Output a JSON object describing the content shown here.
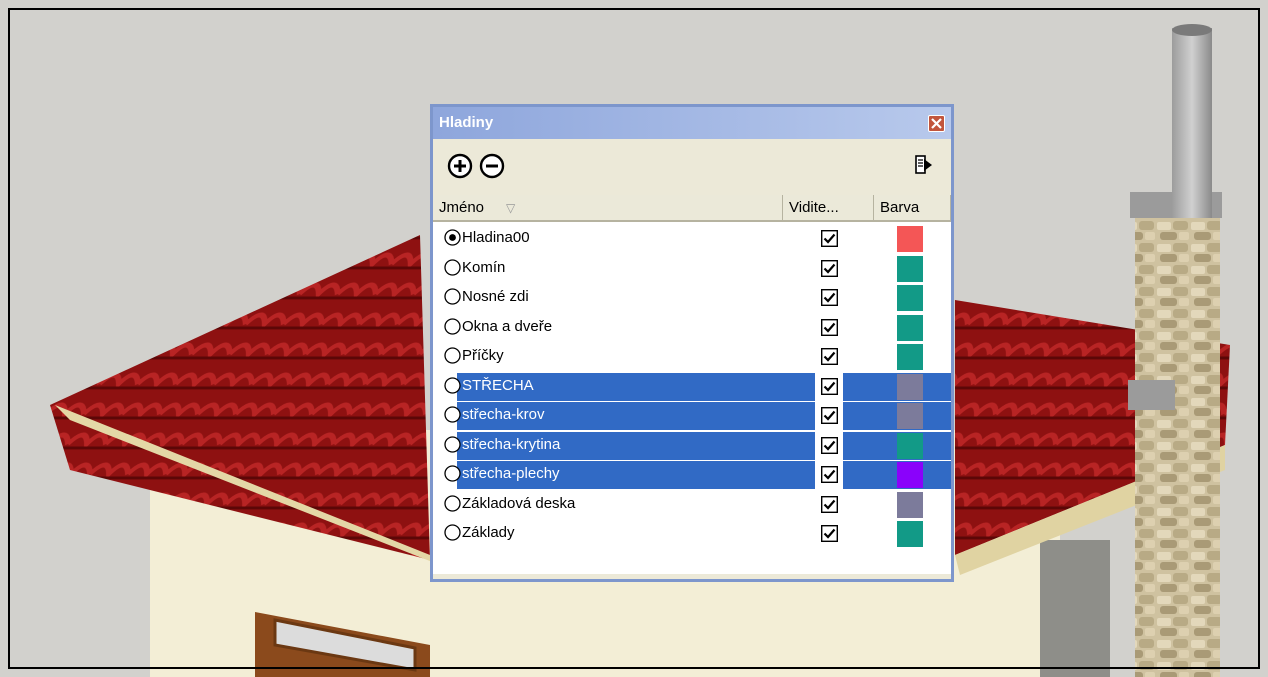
{
  "dialog": {
    "title": "Hladiny",
    "toolbar": {
      "add_icon": "plus-circle-icon",
      "remove_icon": "minus-circle-icon",
      "details_icon": "details-arrow-icon"
    },
    "columns": {
      "name": "Jméno",
      "visible": "Vidite...",
      "color": "Barva"
    },
    "layers": [
      {
        "name": "Hladina00",
        "active": true,
        "visible": true,
        "selected": false,
        "color": "#f45656"
      },
      {
        "name": "Komín",
        "active": false,
        "visible": true,
        "selected": false,
        "color": "#129a87"
      },
      {
        "name": "Nosné zdi",
        "active": false,
        "visible": true,
        "selected": false,
        "color": "#129a87"
      },
      {
        "name": "Okna a dveře",
        "active": false,
        "visible": true,
        "selected": false,
        "color": "#129a87"
      },
      {
        "name": "Příčky",
        "active": false,
        "visible": true,
        "selected": false,
        "color": "#129a87"
      },
      {
        "name": "STŘECHA",
        "active": false,
        "visible": true,
        "selected": true,
        "color": "#7c7b9b"
      },
      {
        "name": "střecha-krov",
        "active": false,
        "visible": true,
        "selected": true,
        "color": "#7c7b9b"
      },
      {
        "name": "střecha-krytina",
        "active": false,
        "visible": true,
        "selected": true,
        "color": "#129a87"
      },
      {
        "name": "střecha-plechy",
        "active": false,
        "visible": true,
        "selected": true,
        "color": "#8a02fb"
      },
      {
        "name": "Základová deska",
        "active": false,
        "visible": true,
        "selected": false,
        "color": "#7c7b9b"
      },
      {
        "name": "Základy",
        "active": false,
        "visible": true,
        "selected": false,
        "color": "#129a87"
      }
    ]
  },
  "colors": {
    "viewport_bg": "#d2d1cd",
    "selection": "#316ac5",
    "titlebar_start": "#8ea6dc",
    "titlebar_end": "#b8c9ec",
    "dialog_bg": "#ece9d8"
  }
}
